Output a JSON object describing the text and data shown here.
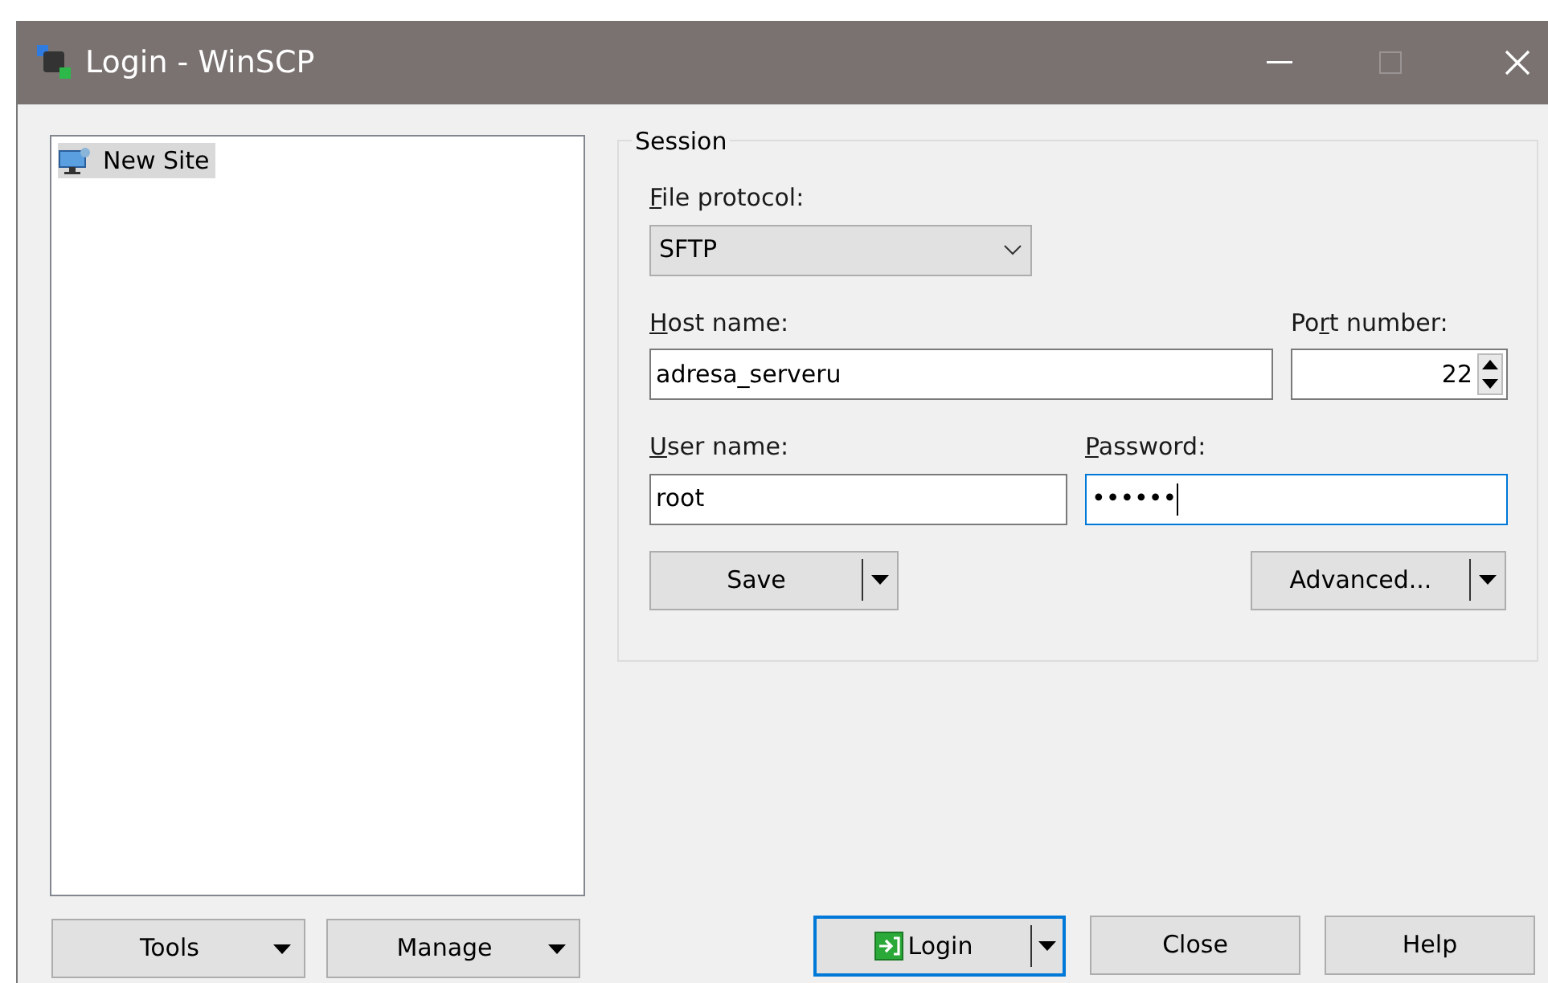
{
  "window": {
    "title": "Login - WinSCP"
  },
  "sites": [
    {
      "label": "New Site",
      "selected": true
    }
  ],
  "session": {
    "title": "Session",
    "protocol": {
      "label": {
        "key": "F",
        "after": "ile protocol:"
      },
      "value": "SFTP"
    },
    "host": {
      "label": {
        "key": "H",
        "after": "ost name:"
      },
      "value": "adresa_serveru"
    },
    "port": {
      "label": {
        "before": "Po",
        "key": "r",
        "after": "t number:"
      },
      "value": "22"
    },
    "user": {
      "label": {
        "key": "U",
        "after": "ser name:"
      },
      "value": "root"
    },
    "password": {
      "label": {
        "key": "P",
        "after": "assword:"
      },
      "value": "••••••",
      "focused": true
    },
    "save_button": "Save",
    "advanced_button": "Advanced..."
  },
  "left_buttons": [
    "Tools",
    "Manage"
  ],
  "login_button": {
    "label": "Login",
    "focused": true
  },
  "buttons": [
    "Close",
    "Help"
  ]
}
